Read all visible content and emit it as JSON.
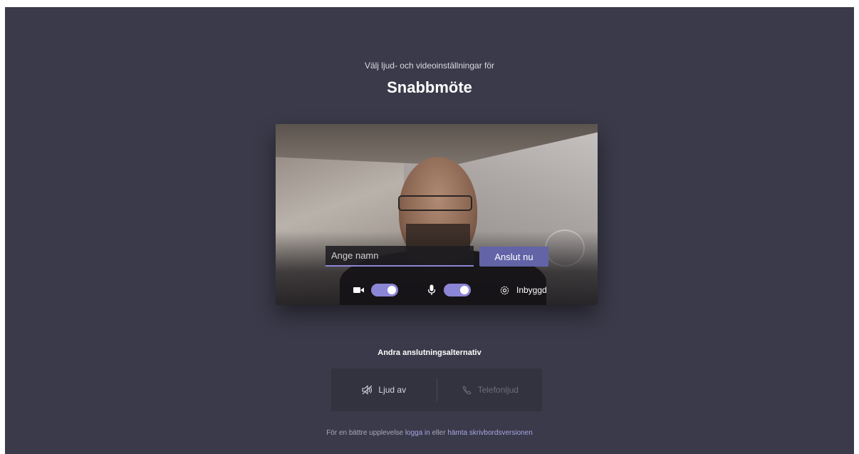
{
  "header": {
    "subtitle": "Välj ljud- och videoinställningar för",
    "meeting_title": "Snabbmöte"
  },
  "preview": {
    "name_placeholder": "Ange namn",
    "join_label": "Anslut nu",
    "camera_on": true,
    "mic_on": true,
    "device_label": "Inbyggd"
  },
  "other_options": {
    "title": "Andra anslutningsalternativ",
    "audio_off_label": "Ljud av",
    "phone_audio_label": "Telefonljud"
  },
  "footer": {
    "prefix": "För en bättre upplevelse",
    "login_link": "logga in",
    "middle": "eller",
    "desktop_link": "hämta skrivbordsversionen"
  },
  "colors": {
    "background": "#3b3a4a",
    "accent": "#6264a7",
    "toggle_on": "#8b86d6"
  }
}
